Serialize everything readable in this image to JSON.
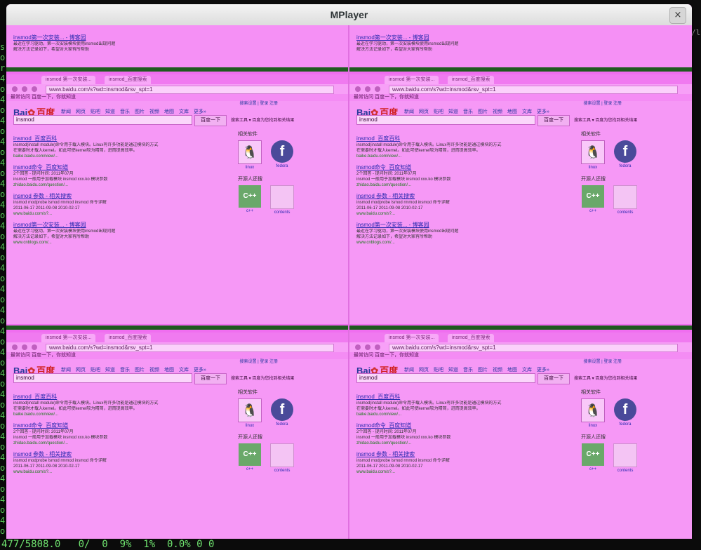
{
  "window": {
    "title": "MPlayer",
    "close_glyph": "×"
  },
  "terminal": {
    "gutter_chars": [
      "s",
      "o",
      "r",
      "4",
      "o",
      "4",
      "o",
      "4",
      "o",
      "4",
      "o",
      "4",
      "o",
      "4",
      "o",
      "4",
      "o",
      "4",
      "o",
      "4",
      "o",
      "4",
      "o",
      "4",
      "o",
      "4",
      "o",
      "4",
      "o",
      "4",
      "o",
      "4",
      "o",
      "4",
      "o",
      "4",
      "o",
      "4",
      "o",
      "4",
      "o",
      "4",
      "o",
      "4",
      "o",
      "4",
      "o",
      "4"
    ],
    "right_chars": "/lt",
    "status": "477/5808.0   0/  0  9%  1%  0.0% 0 0"
  },
  "browser": {
    "tab1": "insmod 第一次安装...",
    "tab2": "insmod_百度搜索",
    "url_left": "www.baidu.com/s?wd=insmod&rsv_spt=1",
    "url_right": "www.baidu.com/s?wd=insmod&rsv_spt=1",
    "bookmarks": "最常访问    百度一下，你就知道",
    "logo_bai": "Bai",
    "logo_du": "百度",
    "nav_items": [
      "新闻",
      "网页",
      "贴吧",
      "知道",
      "音乐",
      "图片",
      "视频",
      "地图",
      "文库",
      "更多»"
    ],
    "toplinks": "搜索设置  |  登录  注册",
    "query": "insmod",
    "search_button": "百度一下",
    "hint": "搜索工具 ▾  百度为您找到相关结果",
    "results": [
      {
        "title": "insmod_百度百科",
        "lines": [
          "insmod(install module)命令用于载入模块。Linux有许多功能是通过模块的方式",
          "在需要时才载入kernel。如此可使kernel较为精简，进而提高效率。"
        ],
        "url": "baike.baidu.com/view/..."
      },
      {
        "title": "insmod命令_百度知道",
        "lines": [
          "2个回答 - 提问时间: 2011年07月",
          "insmod 一般用于加载模块 insmod xxx.ko 模块参数"
        ],
        "url": "zhidao.baidu.com/question/..."
      },
      {
        "title": "insmod 参数 - 相关搜索",
        "lines": [
          "insmod modprobe  lsmod  rmmod  insmod 命令详解",
          "2011-06-17   2011-09-08   2010-02-17"
        ],
        "url": "www.baidu.com/s?..."
      },
      {
        "title": "insmod第一次安装... - 博客园",
        "lines": [
          "最近在学习驱动，第一次安装模块使用insmod出现问题",
          "解决方法记录如下，希望对大家有所帮助"
        ],
        "url": "www.cnblogs.com/..."
      }
    ],
    "side_heading_1": "相关软件",
    "side_heading_2": "开源人还搜",
    "side_items_1": [
      "linux",
      "fedora"
    ],
    "side_items_2": [
      "c++",
      "contents"
    ],
    "thumb_tux": "🐧",
    "thumb_fed": "f",
    "thumb_cpp": "C++"
  }
}
